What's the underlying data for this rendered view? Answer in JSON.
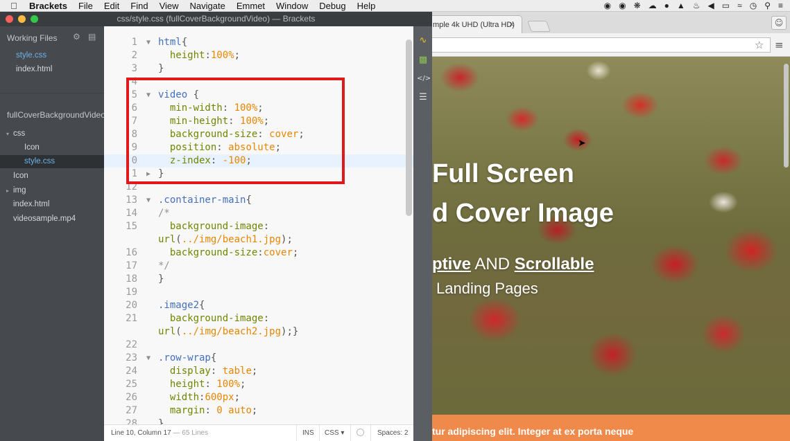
{
  "menubar": {
    "app": "Brackets",
    "items": [
      "File",
      "Edit",
      "Find",
      "View",
      "Navigate",
      "Emmet",
      "Window",
      "Debug",
      "Help"
    ],
    "status_icons": [
      "shield-icon",
      "stop-icon",
      "sun-icon",
      "cloud-icon",
      "person-icon",
      "drive-icon",
      "bell-icon",
      "volume-icon",
      "battery-icon",
      "wifi-icon",
      "clock-icon",
      "search-icon",
      "list-icon"
    ]
  },
  "brackets": {
    "title": "css/style.css (fullCoverBackgroundVideo) — Brackets",
    "sidebar": {
      "working_files_label": "Working Files",
      "working_files": [
        {
          "name": "style.css",
          "active": true
        },
        {
          "name": "index.html",
          "active": false
        }
      ],
      "project_title": "fullCoverBackgroundVideo",
      "tree": [
        {
          "label": "css",
          "arrow": "▾",
          "selected": false
        },
        {
          "label": "Icon",
          "arrow": "",
          "selected": false
        },
        {
          "label": "style.css",
          "arrow": "",
          "selected": true
        },
        {
          "label": "Icon",
          "arrow": "",
          "selected": false
        },
        {
          "label": "img",
          "arrow": "▸",
          "selected": false
        },
        {
          "label": "index.html",
          "arrow": "",
          "selected": false
        },
        {
          "label": "videosample.mp4",
          "arrow": "",
          "selected": false
        }
      ]
    },
    "status": {
      "position": "Line 10, Column 17",
      "lines": "65 Lines",
      "mode": "INS",
      "language": "CSS ▾",
      "spaces": "Spaces: 2"
    }
  },
  "code_lines": [
    {
      "n": "1",
      "fold": "▼",
      "text": "html{"
    },
    {
      "n": "2",
      "fold": "",
      "text": "  height:100%;"
    },
    {
      "n": "3",
      "fold": "",
      "text": "}"
    },
    {
      "n": "4",
      "fold": "",
      "text": ""
    },
    {
      "n": "5",
      "fold": "▼",
      "text": "video {"
    },
    {
      "n": "6",
      "fold": "",
      "text": "  min-width: 100%;"
    },
    {
      "n": "7",
      "fold": "",
      "text": "  min-height: 100%;"
    },
    {
      "n": "8",
      "fold": "",
      "text": "  background-size: cover;"
    },
    {
      "n": "9",
      "fold": "",
      "text": "  position: absolute;"
    },
    {
      "n": "0",
      "fold": "",
      "text": "  z-index: -100;"
    },
    {
      "n": "1",
      "fold": "▶",
      "text": "}"
    },
    {
      "n": "12",
      "fold": "",
      "text": ""
    },
    {
      "n": "13",
      "fold": "▼",
      "text": ".container-main{"
    },
    {
      "n": "14",
      "fold": "",
      "text": "/*"
    },
    {
      "n": "15",
      "fold": "",
      "text": "  background-image:"
    },
    {
      "n": "",
      "fold": "",
      "text": "url(../img/beach1.jpg);"
    },
    {
      "n": "16",
      "fold": "",
      "text": "  background-size:cover;"
    },
    {
      "n": "17",
      "fold": "",
      "text": "*/"
    },
    {
      "n": "18",
      "fold": "",
      "text": "}"
    },
    {
      "n": "19",
      "fold": "",
      "text": ""
    },
    {
      "n": "20",
      "fold": "",
      "text": ".image2{"
    },
    {
      "n": "21",
      "fold": "",
      "text": "  background-image:"
    },
    {
      "n": "",
      "fold": "",
      "text": "url(../img/beach2.jpg);}"
    },
    {
      "n": "22",
      "fold": "",
      "text": ""
    },
    {
      "n": "23",
      "fold": "▼",
      "text": ".row-wrap{"
    },
    {
      "n": "24",
      "fold": "",
      "text": "  display: table;"
    },
    {
      "n": "25",
      "fold": "",
      "text": "  height: 100%;"
    },
    {
      "n": "26",
      "fold": "",
      "text": "  width:600px;"
    },
    {
      "n": "27",
      "fold": "",
      "text": "  margin: 0 auto;"
    },
    {
      "n": "28",
      "fold": "",
      "text": "}"
    }
  ],
  "browser": {
    "tab_title": "mple 4k UHD (Ultra HD)",
    "tab_close": "×",
    "hero_line1": "Full Screen",
    "hero_line2": "d Cover Image",
    "tagline_part1": "ptive",
    "tagline_and": " AND ",
    "tagline_part2": "Scrollable",
    "subtitle": "Landing Pages",
    "band_text": "tur adipiscing elit. Integer at ex porta neque"
  },
  "colors": {
    "highlight_box": "#e01a1a",
    "orange_band": "#f08a4b",
    "active_file": "#6fb3ea"
  }
}
